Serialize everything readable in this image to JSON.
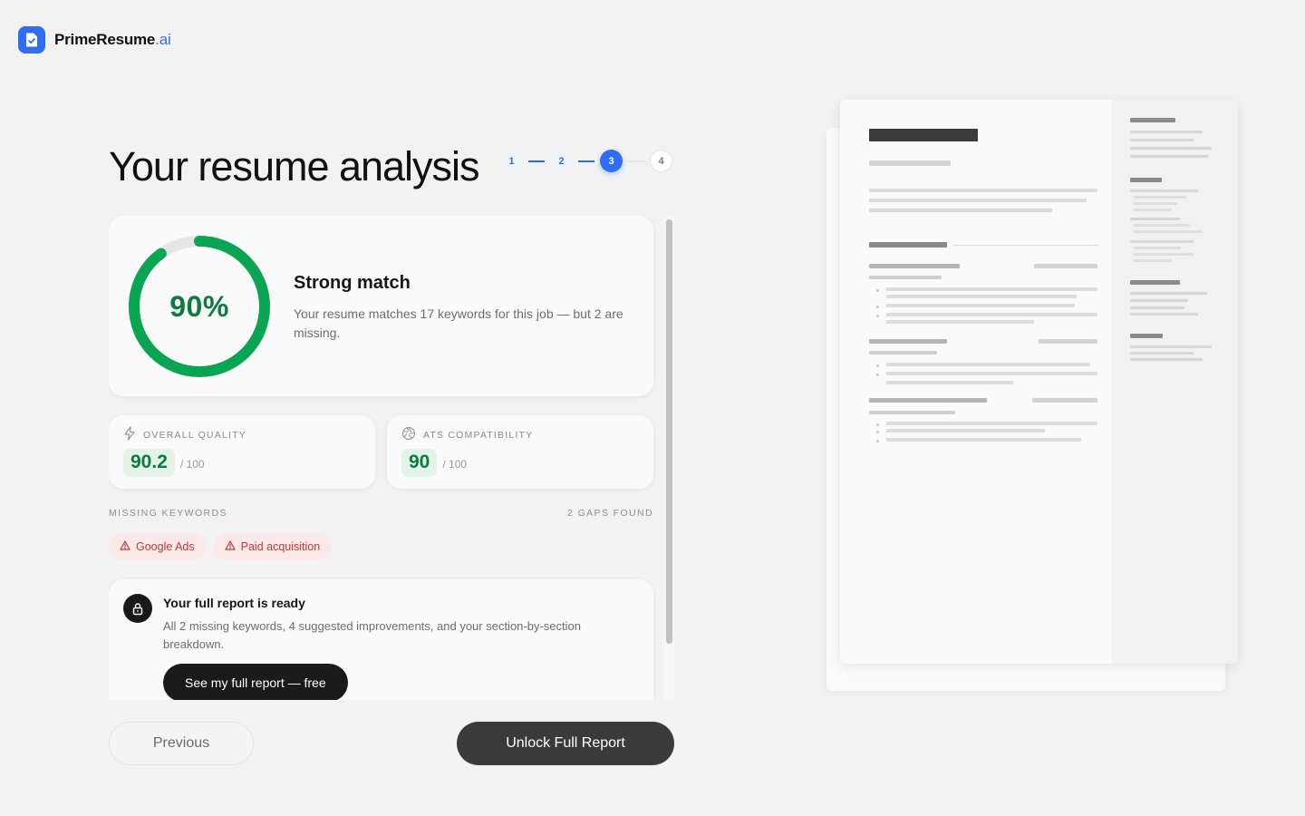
{
  "brand": {
    "name": "PrimeResume",
    "suffix": ".ai",
    "accent_color": "#2f6ef3",
    "logo_icon": "document-check-icon"
  },
  "page": {
    "title": "Your resume analysis"
  },
  "stepper": {
    "steps": [
      {
        "label": "1",
        "state": "done"
      },
      {
        "label": "2",
        "state": "done"
      },
      {
        "label": "3",
        "state": "current"
      },
      {
        "label": "4",
        "state": "todo"
      }
    ]
  },
  "match": {
    "percent_label": "90%",
    "percent": 90,
    "ring_color": "#0aa553",
    "title": "Strong match",
    "description": "Your resume matches 17 keywords for this job — but 2 are missing."
  },
  "scores": {
    "quality": {
      "label": "OVERALL QUALITY",
      "value": "90.2",
      "max": "/ 100",
      "icon": "lightning-icon"
    },
    "ats": {
      "label": "ATS COMPATIBILITY",
      "value": "90",
      "max": "/ 100",
      "icon": "aperture-icon"
    }
  },
  "missing_keywords": {
    "heading": "MISSING KEYWORDS",
    "count_label": "2 GAPS FOUND",
    "items": [
      "Google Ads",
      "Paid acquisition"
    ],
    "icon": "warning-triangle-icon",
    "color": "#c0393b"
  },
  "report": {
    "icon": "lock-icon",
    "title": "Your full report is ready",
    "description": "All 2 missing keywords, 4 suggested improvements, and your section-by-section breakdown.",
    "button": "See my full report — free"
  },
  "footer": {
    "previous": "Previous",
    "unlock": "Unlock Full Report"
  }
}
